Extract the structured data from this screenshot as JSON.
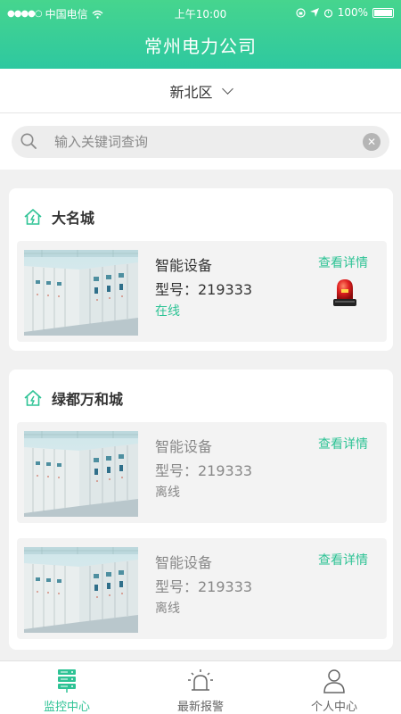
{
  "status_bar": {
    "carrier": "中国电信",
    "time": "上午10:00",
    "battery": "100%"
  },
  "header": {
    "title": "常州电力公司"
  },
  "district": {
    "label": "新北区"
  },
  "search": {
    "placeholder": "输入关键词查询",
    "value": ""
  },
  "groups": [
    {
      "name": "大名城",
      "devices": [
        {
          "name": "智能设备",
          "model": "型号：219333",
          "status": "在线",
          "detail": "查看详情",
          "alarm": true
        }
      ]
    },
    {
      "name": "绿都万和城",
      "devices": [
        {
          "name": "智能设备",
          "model": "型号：219333",
          "status": "离线",
          "detail": "查看详情",
          "alarm": false
        },
        {
          "name": "智能设备",
          "model": "型号：219333",
          "status": "离线",
          "detail": "查看详情",
          "alarm": false
        }
      ]
    }
  ],
  "tabbar": {
    "items": [
      {
        "label": "监控中心",
        "icon": "server-icon",
        "active": true
      },
      {
        "label": "最新报警",
        "icon": "alarm-light-icon",
        "active": false
      },
      {
        "label": "个人中心",
        "icon": "person-icon",
        "active": false
      }
    ]
  },
  "colors": {
    "accent": "#2ec395",
    "header_start": "#46d58e",
    "header_end": "#2ec8a0",
    "alarm_red": "#d01818"
  }
}
